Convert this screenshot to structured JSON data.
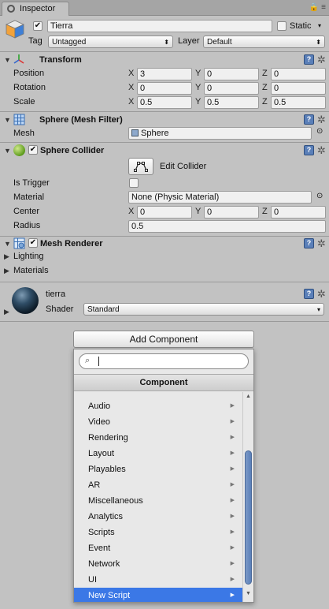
{
  "window": {
    "tab_title": "Inspector",
    "lock_icons": "🔒 ≡"
  },
  "object": {
    "active": true,
    "name": "Tierra",
    "static_label": "Static",
    "static_checked": false,
    "tag_label": "Tag",
    "tag_value": "Untagged",
    "layer_label": "Layer",
    "layer_value": "Default"
  },
  "transform": {
    "title": "Transform",
    "position_label": "Position",
    "rotation_label": "Rotation",
    "scale_label": "Scale",
    "x": "X",
    "y": "Y",
    "z": "Z",
    "position": {
      "x": "3",
      "y": "0",
      "z": "0"
    },
    "rotation": {
      "x": "0",
      "y": "0",
      "z": "0"
    },
    "scale": {
      "x": "0.5",
      "y": "0.5",
      "z": "0.5"
    }
  },
  "mesh_filter": {
    "title": "Sphere (Mesh Filter)",
    "mesh_label": "Mesh",
    "mesh_value": "Sphere"
  },
  "sphere_collider": {
    "title": "Sphere Collider",
    "enabled": true,
    "edit_collider": "Edit Collider",
    "is_trigger_label": "Is Trigger",
    "is_trigger": false,
    "material_label": "Material",
    "material_value": "None (Physic Material)",
    "center_label": "Center",
    "center": {
      "x": "0",
      "y": "0",
      "z": "0"
    },
    "radius_label": "Radius",
    "radius_value": "0.5"
  },
  "mesh_renderer": {
    "title": "Mesh Renderer",
    "enabled": true,
    "lighting": "Lighting",
    "materials": "Materials"
  },
  "material": {
    "name": "tierra",
    "shader_label": "Shader",
    "shader_value": "Standard"
  },
  "add_component": {
    "button_label": "Add Component",
    "search_value": "",
    "header": "Component",
    "items": [
      {
        "label": "Audio"
      },
      {
        "label": "Video"
      },
      {
        "label": "Rendering"
      },
      {
        "label": "Layout"
      },
      {
        "label": "Playables"
      },
      {
        "label": "AR"
      },
      {
        "label": "Miscellaneous"
      },
      {
        "label": "Analytics"
      },
      {
        "label": "Scripts"
      },
      {
        "label": "Event"
      },
      {
        "label": "Network"
      },
      {
        "label": "UI"
      },
      {
        "label": "New Script"
      }
    ],
    "selected_index": 12
  },
  "colors": {
    "accent": "#3b78e6",
    "panel": "#c2c2c2",
    "help_icon": "#5a7fb8"
  }
}
